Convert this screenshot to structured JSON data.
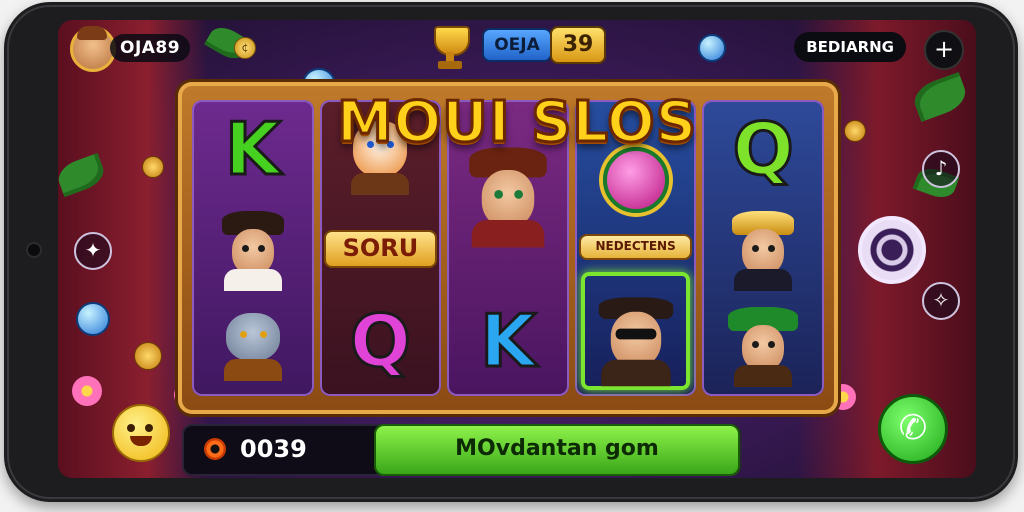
{
  "hud": {
    "player_name": "OJA89",
    "level_label": "OEJA",
    "level_value": "39",
    "bonus_label": "BEDIARNG",
    "settings_symbol": "+",
    "coin_symbol": "¢"
  },
  "game": {
    "title": "MOUI SLOS",
    "reels": [
      {
        "symbols": [
          {
            "type": "letter",
            "text": "K",
            "color": "#46d01f"
          },
          {
            "type": "character",
            "name": "gnome-wizard"
          },
          {
            "type": "character",
            "name": "gray-cat"
          }
        ]
      },
      {
        "symbols": [
          {
            "type": "character",
            "name": "fox-hero"
          },
          {
            "type": "badge",
            "text": "SORU"
          },
          {
            "type": "letter",
            "text": "Q",
            "color": "#e044d6"
          }
        ]
      },
      {
        "symbols": [
          {
            "type": "character",
            "name": "captain-girl"
          },
          {
            "type": "letter",
            "text": "K",
            "color": "#2aa7f0"
          }
        ]
      },
      {
        "symbols": [
          {
            "type": "emblem",
            "text": "NEDECTENS"
          },
          {
            "type": "character",
            "name": "sunglasses-man",
            "highlighted": true
          }
        ]
      },
      {
        "symbols": [
          {
            "type": "letter",
            "text": "Q",
            "color": "#7ee22a"
          },
          {
            "type": "character",
            "name": "gold-helmet-woman"
          },
          {
            "type": "character",
            "name": "green-hat-man"
          }
        ]
      }
    ]
  },
  "bottom": {
    "bet_value": "0039",
    "spin_label": "MOvdantan gom"
  },
  "icons": {
    "settings": "gear-icon",
    "phone": "phone-icon",
    "smiley": "smiley-icon",
    "spiral": "spiral-icon"
  },
  "colors": {
    "accent_gold": "#ffd11a",
    "spin_green": "#3aa71a",
    "frame_wood": "#c07a2a"
  }
}
